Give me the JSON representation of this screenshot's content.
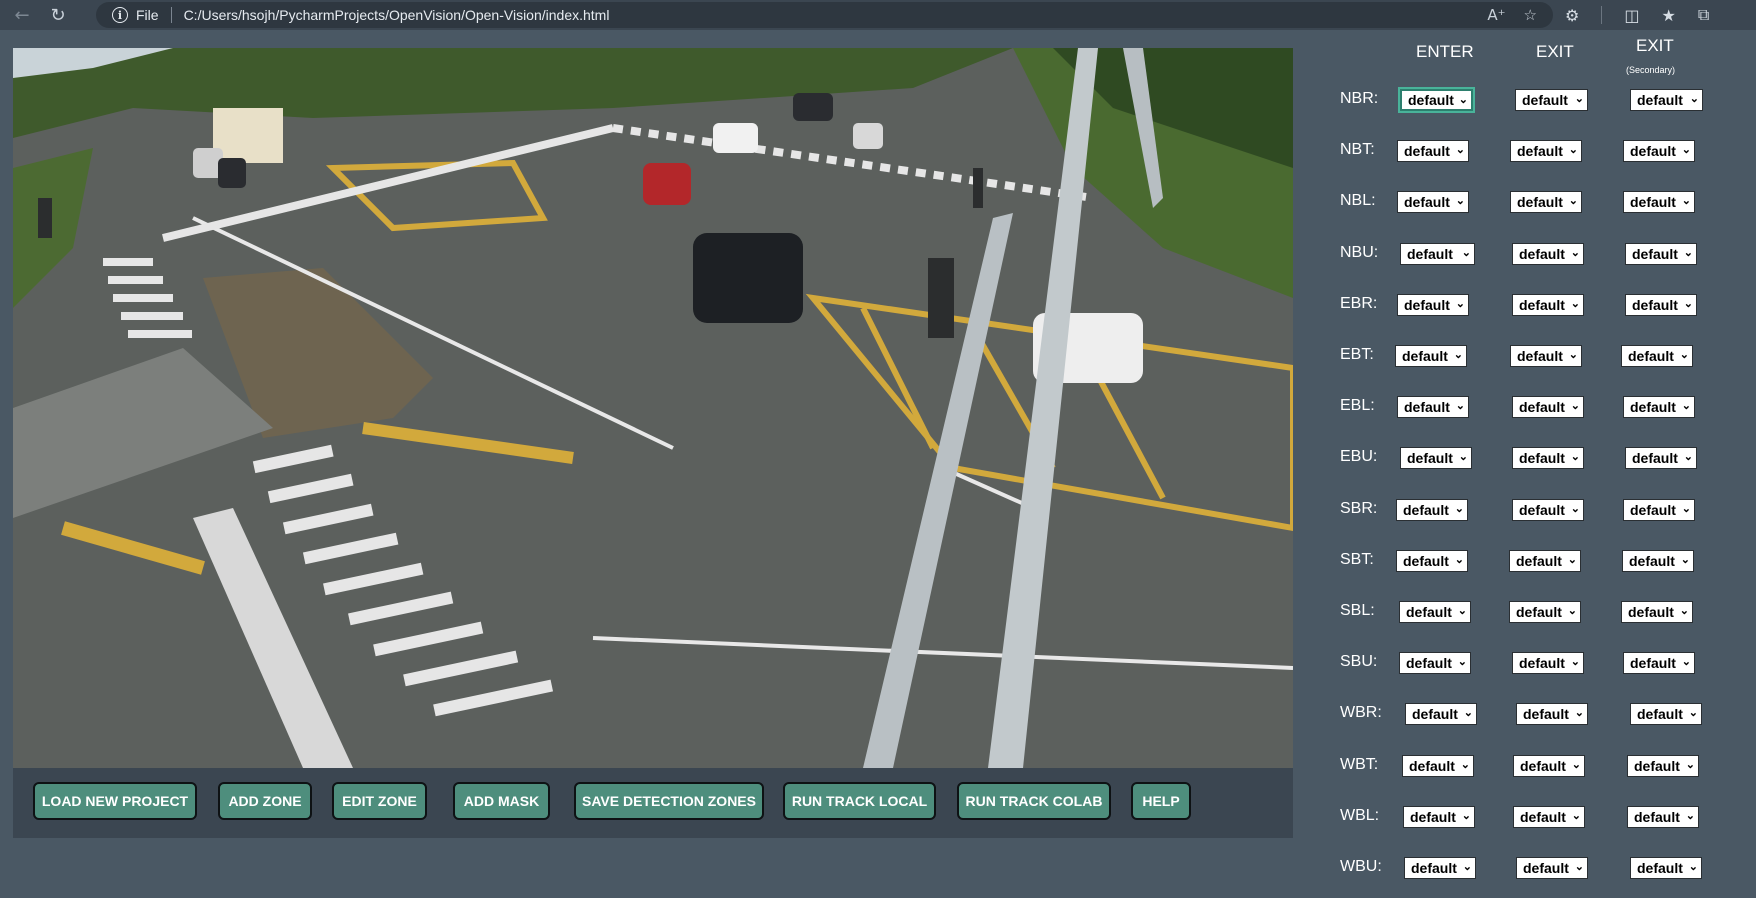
{
  "browser": {
    "scheme_label": "File",
    "url": "C:/Users/hsojh/PycharmProjects/OpenVision/Open-Vision/index.html",
    "icons": [
      "back-icon",
      "refresh-icon",
      "info-icon",
      "read-aloud-icon",
      "favorite-icon",
      "extensions-icon",
      "split-screen-icon",
      "favorites-icon",
      "collections-icon"
    ]
  },
  "colors": {
    "page_bg": "#4a5864",
    "toolbar_bg": "#3b4651",
    "button_bg": "#4e8e7d",
    "focus_ring": "#49b39a"
  },
  "video": {
    "icon": "camera-feed-image",
    "description_name": "traffic-camera-feed"
  },
  "toolbar": {
    "buttons": [
      {
        "label": "LOAD NEW PROJECT"
      },
      {
        "label": "ADD ZONE"
      },
      {
        "label": "EDIT ZONE"
      },
      {
        "label": "ADD MASK"
      },
      {
        "label": "SAVE DETECTION ZONES"
      },
      {
        "label": "RUN TRACK LOCAL"
      },
      {
        "label": "RUN TRACK COLAB"
      },
      {
        "label": "HELP"
      }
    ]
  },
  "panel": {
    "headers": {
      "enter": "ENTER",
      "exit": "EXIT",
      "exit_secondary": "EXIT",
      "exit_secondary_sub": "(Secondary)"
    },
    "rows": [
      {
        "label": "NBR:",
        "enter": "default",
        "exit": "default",
        "exit2": "default"
      },
      {
        "label": "NBT:",
        "enter": "default",
        "exit": "default",
        "exit2": "default"
      },
      {
        "label": "NBL:",
        "enter": "default",
        "exit": "default",
        "exit2": "default"
      },
      {
        "label": "NBU:",
        "enter": "default",
        "exit": "default",
        "exit2": "default"
      },
      {
        "label": "EBR:",
        "enter": "default",
        "exit": "default",
        "exit2": "default"
      },
      {
        "label": "EBT:",
        "enter": "default",
        "exit": "default",
        "exit2": "default"
      },
      {
        "label": "EBL:",
        "enter": "default",
        "exit": "default",
        "exit2": "default"
      },
      {
        "label": "EBU:",
        "enter": "default",
        "exit": "default",
        "exit2": "default"
      },
      {
        "label": "SBR:",
        "enter": "default",
        "exit": "default",
        "exit2": "default"
      },
      {
        "label": "SBT:",
        "enter": "default",
        "exit": "default",
        "exit2": "default"
      },
      {
        "label": "SBL:",
        "enter": "default",
        "exit": "default",
        "exit2": "default"
      },
      {
        "label": "SBU:",
        "enter": "default",
        "exit": "default",
        "exit2": "default"
      },
      {
        "label": "WBR:",
        "enter": "default",
        "exit": "default",
        "exit2": "default"
      },
      {
        "label": "WBT:",
        "enter": "default",
        "exit": "default",
        "exit2": "default"
      },
      {
        "label": "WBL:",
        "enter": "default",
        "exit": "default",
        "exit2": "default"
      },
      {
        "label": "WBU:",
        "enter": "default",
        "exit": "default",
        "exit2": "default"
      }
    ]
  }
}
